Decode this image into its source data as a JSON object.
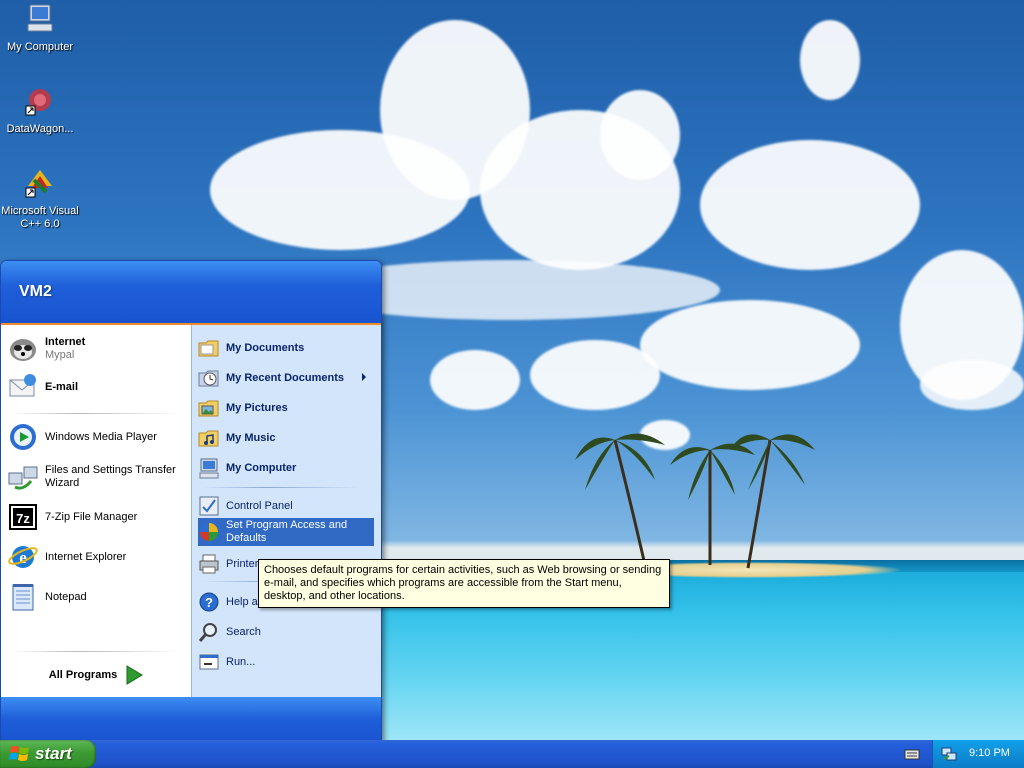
{
  "desktop": {
    "icons": [
      {
        "label": "My Computer"
      },
      {
        "label": "DataWagon..."
      },
      {
        "label": "Microsoft Visual C++ 6.0"
      }
    ]
  },
  "start_menu": {
    "user": "VM2",
    "pinned": [
      {
        "title": "Internet",
        "subtitle": "Mypal"
      },
      {
        "title": "E-mail"
      }
    ],
    "recent": [
      {
        "label": "Windows Media Player"
      },
      {
        "label": "Files and Settings Transfer Wizard"
      },
      {
        "label": "7-Zip File Manager"
      },
      {
        "label": "Internet Explorer"
      },
      {
        "label": "Notepad"
      }
    ],
    "all_programs": "All Programs",
    "right": [
      {
        "label": "My Documents"
      },
      {
        "label": "My Recent Documents"
      },
      {
        "label": "My Pictures"
      },
      {
        "label": "My Music"
      },
      {
        "label": "My Computer"
      },
      {
        "label": "Control Panel"
      },
      {
        "label": "Set Program Access and Defaults"
      },
      {
        "label": "Printer"
      },
      {
        "label": "Help a"
      },
      {
        "label": "Search"
      },
      {
        "label": "Run..."
      }
    ]
  },
  "tooltip": {
    "text": "Chooses default programs for certain activities, such as Web browsing or sending e-mail, and specifies which programs are accessible from the Start menu, desktop, and other locations."
  },
  "taskbar": {
    "start_label": "start",
    "clock": "9:10 PM"
  },
  "colors": {
    "taskbar_blue": "#245edb",
    "start_green": "#3c9a33",
    "highlight": "#316ac5",
    "tooltip_bg": "#ffffe1"
  }
}
